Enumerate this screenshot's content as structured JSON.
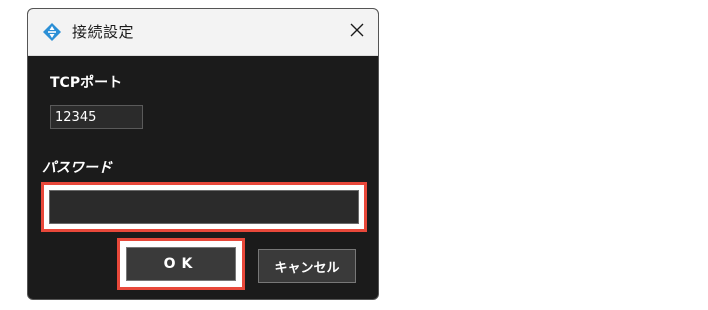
{
  "dialog": {
    "title": "接続設定",
    "close_glyph": "✕",
    "app_icon": "diamond-arrows-icon"
  },
  "form": {
    "tcp_port_label": "TCPポート",
    "tcp_port_value": "12345",
    "password_label": "パスワード",
    "password_value": ""
  },
  "buttons": {
    "ok_label": "OK",
    "cancel_label": "キャンセル"
  },
  "highlight_color": "#e8483a"
}
